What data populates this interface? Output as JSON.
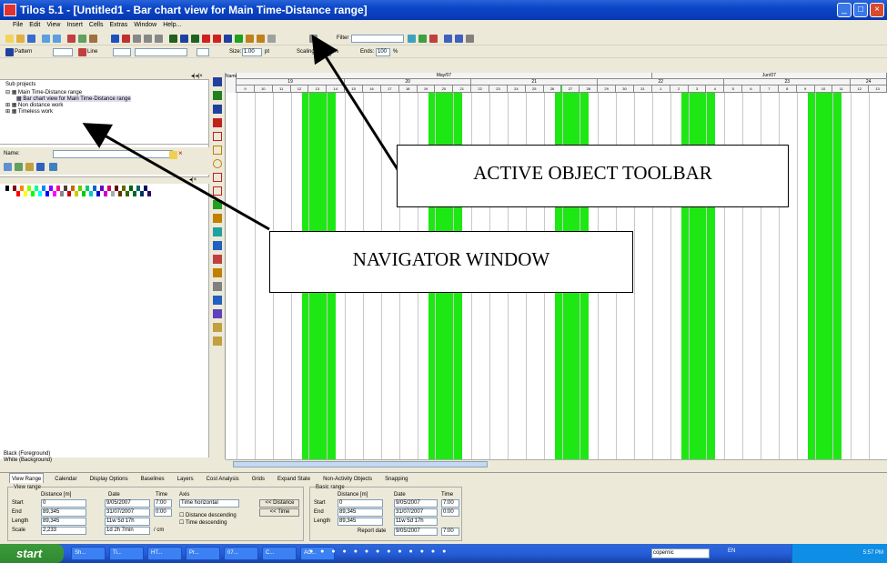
{
  "window": {
    "title": "Tilos 5.1  - [Untitled1 - Bar chart view for Main Time-Distance range]"
  },
  "menubar": [
    "File",
    "Edit",
    "View",
    "Insert",
    "Cells",
    "Extras",
    "Window",
    "Help..."
  ],
  "toolbar": {
    "filter_label": "Filter",
    "pattern_label": "Pattern",
    "line_label": "Line",
    "size_label": "Size:",
    "size_value": "1.00",
    "size_unit": "pt",
    "scaling_label": "Scaling",
    "scaling_unit": "%",
    "ends_label": "Ends:",
    "ends_value": "100",
    "ends_unit": "%"
  },
  "navigator": {
    "subprojects_label": "Sub projects",
    "tree": [
      {
        "label": "Main Time-Distance range",
        "indent": 0
      },
      {
        "label": "Bar chart view for Main Time-Distance range",
        "indent": 1
      },
      {
        "label": "Non distance work",
        "indent": 0
      },
      {
        "label": "Timeless work",
        "indent": 0
      }
    ],
    "name_label": "Name:",
    "foreground_label": "Black (Foreground)",
    "background_label": "White (Background)"
  },
  "gantt": {
    "name_header": "Name",
    "months": [
      {
        "label": "May/07"
      },
      {
        "label": "Jun/07"
      }
    ],
    "weeks": [
      "19",
      "20",
      "21",
      "22",
      "23",
      "24"
    ],
    "days": [
      "9",
      "10",
      "11",
      "12",
      "13",
      "14",
      "15",
      "16",
      "17",
      "18",
      "19",
      "20",
      "21",
      "22",
      "23",
      "24",
      "25",
      "26",
      "27",
      "28",
      "29",
      "30",
      "31",
      "1",
      "2",
      "3",
      "4",
      "5",
      "6",
      "7",
      "8",
      "9",
      "10",
      "11",
      "12",
      "13"
    ]
  },
  "bottom_tabs": [
    "View Range",
    "Calendar",
    "Display Options",
    "Baselines",
    "Layers",
    "Cost Analysis",
    "Grids",
    "Expand State",
    "Non-Activity Objects",
    "Snapping"
  ],
  "view_range": {
    "title": "View range",
    "col_distance": "Distance [m]",
    "col_date": "Date",
    "col_time": "Time",
    "col_axis": "Axis",
    "start_label": "Start",
    "start_distance": "0",
    "start_date": "9/05/2007",
    "start_time": "7:00",
    "end_label": "End",
    "end_distance": "89,345",
    "end_date": "31/07/2007",
    "end_time": "0:00",
    "length_label": "Length",
    "length_distance": "89,345",
    "length_date": "11w 5d 17h",
    "scale_label": "Scale",
    "scale_distance": "2,233",
    "scale_date": "1d 2h 7min",
    "scale_unit": "/ cm",
    "axis_value": "Time horizontal",
    "distance_desc": "Distance descending",
    "time_desc": "Time descending",
    "btn_distance": "<< Distance",
    "btn_time": "<< Time"
  },
  "basic_range": {
    "title": "Basic range",
    "col_distance": "Distance [m]",
    "col_date": "Date",
    "col_time": "Time",
    "start_label": "Start",
    "start_distance": "0",
    "start_date": "9/05/2007",
    "start_time": "7:00",
    "end_label": "End",
    "end_distance": "89,345",
    "end_date": "31/07/2007",
    "end_time": "0:00",
    "length_label": "Length",
    "length_distance": "89,345",
    "length_date": "11w 5d 17h",
    "report_label": "Report date",
    "report_date": "9/05/2007",
    "report_time": "7:00"
  },
  "taskbar": {
    "start_label": "start",
    "tasks": [
      "Sh...",
      "Ti...",
      "HT...",
      "Pr...",
      "07...",
      "C...",
      "AC..."
    ],
    "search_value": "copernic",
    "lang": "EN",
    "clock": "5:57 PM"
  },
  "callouts": {
    "active_object_toolbar": "ACTIVE OBJECT TOOLBAR",
    "navigator_window": "NAVIGATOR WINDOW"
  },
  "colors": {
    "bar": "#1ee814",
    "titlebar": "#0a46c8"
  }
}
